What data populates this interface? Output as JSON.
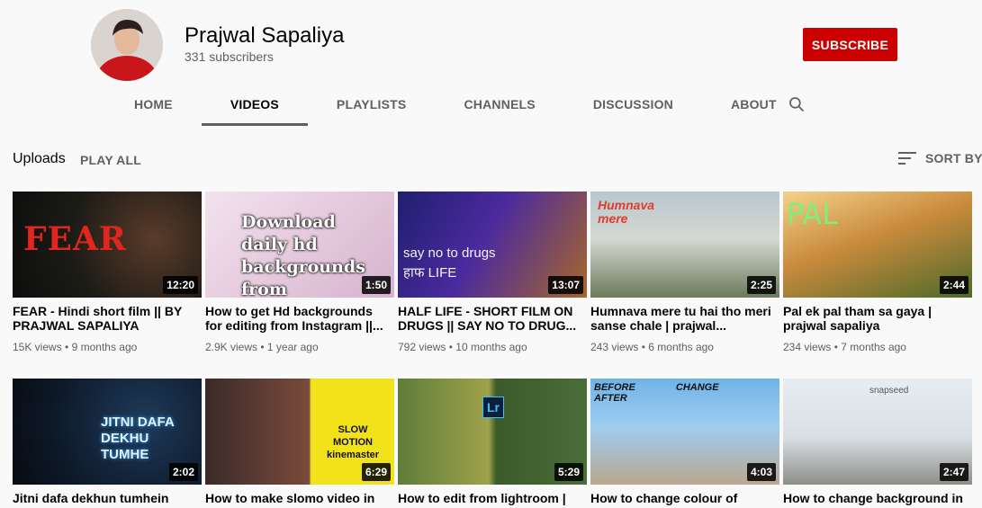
{
  "channel": {
    "name": "Prajwal Sapaliya",
    "subscribers": "331 subscribers",
    "subscribe_label": "SUBSCRIBE"
  },
  "tabs": [
    {
      "label": "HOME",
      "active": false
    },
    {
      "label": "VIDEOS",
      "active": true
    },
    {
      "label": "PLAYLISTS",
      "active": false
    },
    {
      "label": "CHANNELS",
      "active": false
    },
    {
      "label": "DISCUSSION",
      "active": false
    },
    {
      "label": "ABOUT",
      "active": false
    }
  ],
  "uploads": {
    "label": "Uploads",
    "play_all": "PLAY ALL",
    "sort_by": "SORT BY"
  },
  "videos": [
    {
      "title": "FEAR - Hindi short film || BY PRAJWAL SAPALIYA",
      "views": "15K views",
      "age": "9 months ago",
      "duration": "12:20",
      "thumb_text": "FEAR"
    },
    {
      "title": "How to get Hd backgrounds for editing from Instagram ||...",
      "views": "2.9K views",
      "age": "1 year ago",
      "duration": "1:50",
      "thumb_text": "Download daily hd backgrounds from Instagram"
    },
    {
      "title": "HALF LIFE - SHORT FILM ON DRUGS || SAY NO TO DRUG...",
      "views": "792 views",
      "age": "10 months ago",
      "duration": "13:07",
      "thumb_text": "say no to drugs हाफ LIFE"
    },
    {
      "title": "Humnava mere tu hai tho meri sanse chale | prajwal...",
      "views": "243 views",
      "age": "6 months ago",
      "duration": "2:25",
      "thumb_text": "Humnava mere"
    },
    {
      "title": "Pal ek pal tham sa gaya | prajwal sapaliya",
      "views": "234 views",
      "age": "7 months ago",
      "duration": "2:44",
      "thumb_text": "PAL"
    },
    {
      "title": "Jitni dafa dekhun tumhein",
      "views": "",
      "age": "",
      "duration": "2:02",
      "thumb_text": "JITNI DAFA DEKHU TUMHE"
    },
    {
      "title": "How to make slomo video in",
      "views": "",
      "age": "",
      "duration": "6:29",
      "thumb_text": "SLOW MOTION kinemaster"
    },
    {
      "title": "How to edit from lightroom |",
      "views": "",
      "age": "",
      "duration": "5:29",
      "thumb_text": "Lr"
    },
    {
      "title": "How to change colour of",
      "views": "",
      "age": "",
      "duration": "4:03",
      "thumb_text": "BEFORE CHANGE AFTER"
    },
    {
      "title": "How to change background in",
      "views": "",
      "age": "",
      "duration": "2:47",
      "thumb_text": "snapseed"
    }
  ],
  "meta_separator": "•",
  "colors": {
    "subscribe": "#cc0000",
    "background": "#f9f9f9"
  }
}
